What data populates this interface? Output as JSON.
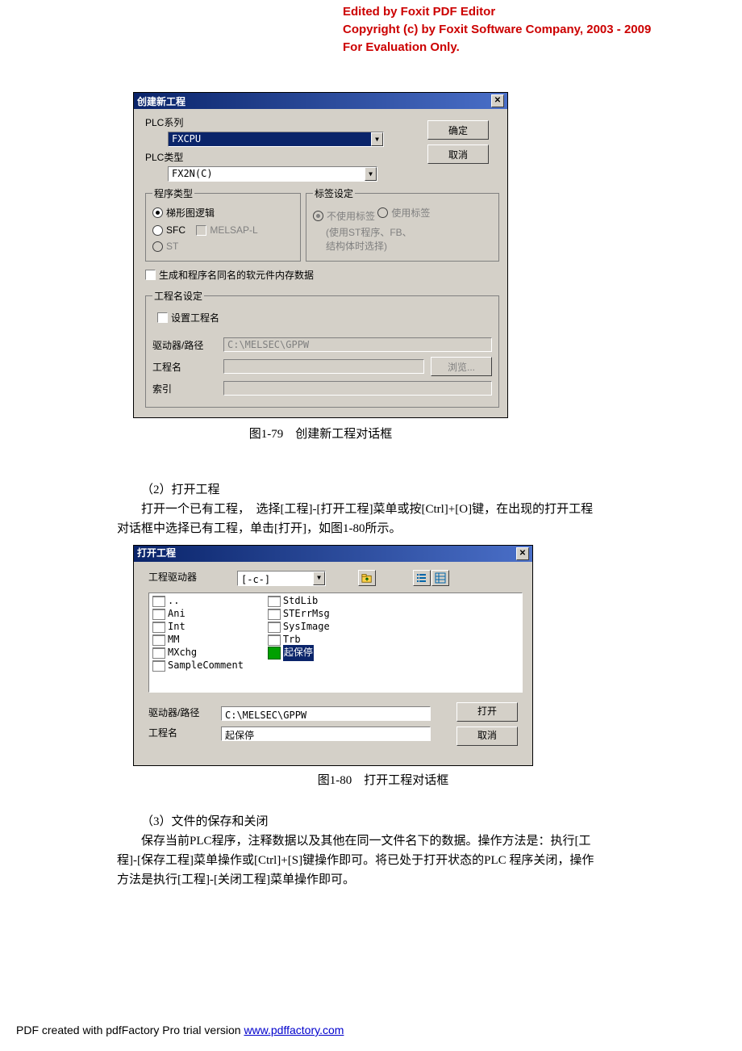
{
  "foxit": {
    "l1": "Edited by Foxit PDF Editor",
    "l2": "Copyright (c) by Foxit Software Company, 2003 - 2009",
    "l3": "For Evaluation Only."
  },
  "dialog1": {
    "title": "创建新工程",
    "ok": "确定",
    "cancel": "取消",
    "plc_series_label": "PLC系列",
    "plc_series_value": "FXCPU",
    "plc_type_label": "PLC类型",
    "plc_type_value": "FX2N(C)",
    "prog_type_legend": "程序类型",
    "prog_type_opts": {
      "ladder": "梯形图逻辑",
      "sfc": "SFC",
      "melsap": "MELSAP-L",
      "st": "ST"
    },
    "label_legend": "标签设定",
    "label_opts": {
      "nouse": "不使用标签",
      "use": "使用标签",
      "hint1": "(使用ST程序、FB、",
      "hint2": "结构体时选择)"
    },
    "gen_mem_chk": "生成和程序名同名的软元件内存数据",
    "proj_legend": "工程名设定",
    "set_proj_chk": "设置工程名",
    "drive_path_lab": "驱动器/路径",
    "drive_path_val": "C:\\MELSEC\\GPPW",
    "proj_name_lab": "工程名",
    "browse_btn": "浏览...",
    "index_lab": "索引"
  },
  "caption1": "图1-79　创建新工程对话框",
  "sec2_p1": "（2）打开工程",
  "sec2_p2a": "打开一个已有工程，　选择[工程]-[打开工程]菜单或按[Ctrl]+[O]键，在出现的打开工程",
  "sec2_p2b": "对话框中选择已有工程，单击[打开]，如图1-80所示。",
  "dialog2": {
    "title": "打开工程",
    "drive_lab": "工程驱动器",
    "drive_val": "[-c-]",
    "col1": [
      "..",
      "Ani",
      "Int",
      "MM",
      "MXchg",
      "SampleComment"
    ],
    "col2": [
      "StdLib",
      "STErrMsg",
      "SysImage",
      "Trb"
    ],
    "selected_proj": "起保停",
    "path_lab": "驱动器/路径",
    "path_val": "C:\\MELSEC\\GPPW",
    "proj_lab": "工程名",
    "proj_val": "起保停",
    "open_btn": "打开",
    "cancel_btn": "取消"
  },
  "caption2": "图1-80　打开工程对话框",
  "sec3_p1": "（3）文件的保存和关闭",
  "sec3_p2a": "保存当前PLC程序，注释数据以及其他在同一文件名下的数据。操作方法是：执行[工",
  "sec3_p2b": "程]-[保存工程]菜单操作或[Ctrl]+[S]键操作即可。将已处于打开状态的PLC 程序关闭，操作",
  "sec3_p2c": "方法是执行[工程]-[关闭工程]菜单操作即可。",
  "footer_pre": "PDF created with pdfFactory Pro trial version ",
  "footer_link": "www.pdffactory.com"
}
